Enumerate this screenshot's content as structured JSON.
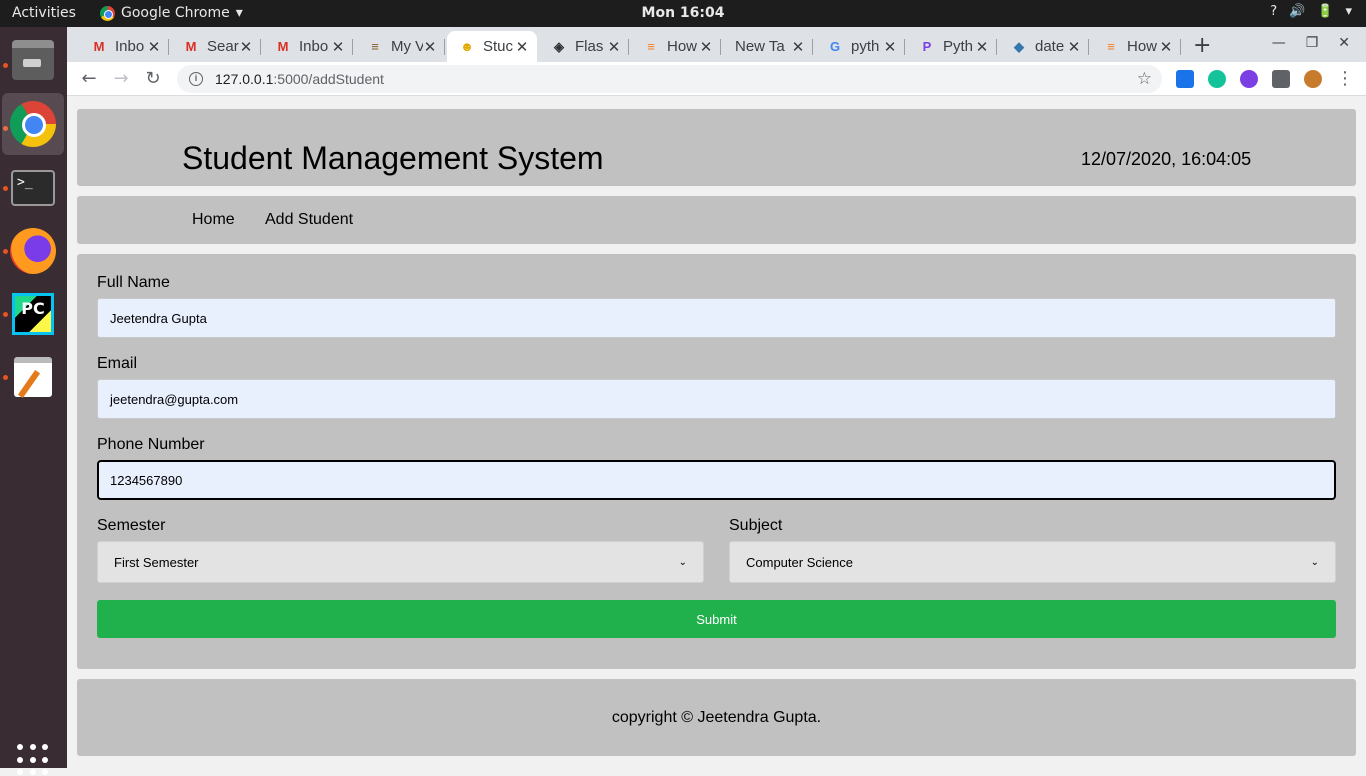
{
  "topbar": {
    "activities": "Activities",
    "app_name": "Google Chrome",
    "app_menu_arrow": "▾",
    "clock": "Mon 16:04",
    "help": "?",
    "volume": "🔊",
    "battery": "🔋",
    "menu": "▾"
  },
  "browser": {
    "tabs": [
      {
        "title": "Inbo",
        "icon": "M",
        "icon_color": "#d93025"
      },
      {
        "title": "Sear",
        "icon": "M",
        "icon_color": "#d93025"
      },
      {
        "title": "Inbo",
        "icon": "M",
        "icon_color": "#d93025"
      },
      {
        "title": "My V",
        "icon": "≡",
        "icon_color": "#8a5a2b"
      },
      {
        "title": "Stuc",
        "icon": "☻",
        "icon_color": "#e0a800"
      },
      {
        "title": "Flas",
        "icon": "◈",
        "icon_color": "#333333"
      },
      {
        "title": "How",
        "icon": "≡",
        "icon_color": "#f48024"
      },
      {
        "title": "New Ta",
        "icon": "",
        "icon_color": "#3c4043"
      },
      {
        "title": "pyth",
        "icon": "G",
        "icon_color": "#4285f4"
      },
      {
        "title": "Pyth",
        "icon": "P",
        "icon_color": "#7b3fe4"
      },
      {
        "title": "date",
        "icon": "◆",
        "icon_color": "#3776ab"
      },
      {
        "title": "How",
        "icon": "≡",
        "icon_color": "#f48024"
      }
    ],
    "close_glyph": "✕",
    "new_tab": "+",
    "window_controls": {
      "minimize": "—",
      "restore": "❐",
      "close": "✕"
    },
    "nav": {
      "back": "←",
      "forward": "→",
      "reload": "↻"
    },
    "address": {
      "host": "127.0.0.1",
      "path": ":5000/addStudent",
      "info": "i",
      "star": "☆"
    },
    "extension_colors": [
      "#1a73e8",
      "#15c39a",
      "#7b3fe4",
      "#5f6368",
      "#c77b2c"
    ],
    "menu_dots": "⋮"
  },
  "dock": {
    "items": [
      "files-icon",
      "chrome-icon",
      "terminal-icon",
      "firefox-icon",
      "pycharm-icon",
      "text-editor-icon"
    ],
    "terminal_prompt": ">_",
    "pycharm_label": "PC"
  },
  "app": {
    "title": "Student Management System",
    "datetime": "12/07/2020, 16:04:05",
    "nav": {
      "home": "Home",
      "add_student": "Add Student"
    },
    "form": {
      "full_name_label": "Full Name",
      "full_name_value": "Jeetendra Gupta",
      "email_label": "Email",
      "email_value": "jeetendra@gupta.com",
      "phone_label": "Phone Number",
      "phone_value": "1234567890",
      "semester_label": "Semester",
      "semester_value": "First Semester",
      "subject_label": "Subject",
      "subject_value": "Computer Science",
      "submit_label": "Submit",
      "caret": "⌄"
    },
    "footer": "copyright © Jeetendra Gupta."
  }
}
